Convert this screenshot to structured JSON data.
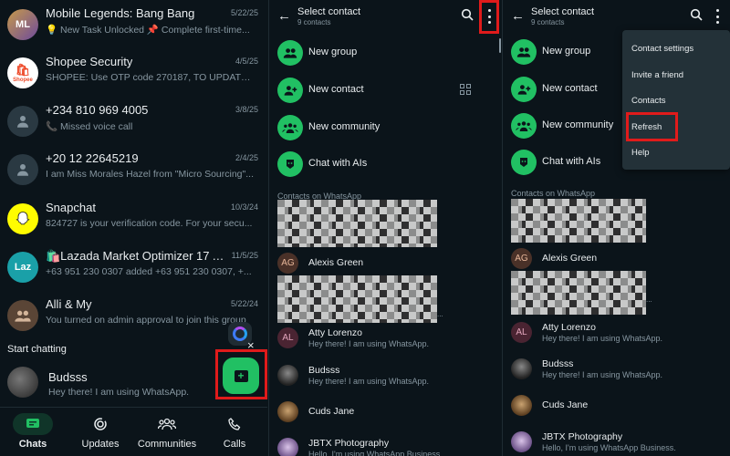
{
  "chats_panel": {
    "chats": [
      {
        "name": "Mobile Legends: Bang Bang",
        "date": "5/22/25",
        "preview": "💡 New Task Unlocked 📌 Complete first-time...",
        "avatar_text": "ML"
      },
      {
        "name": "Shopee Security",
        "date": "4/5/25",
        "preview": "SHOPEE: Use OTP code 270187, TO UPDATE P...",
        "avatar_text": "Shopee"
      },
      {
        "name": "+234 810 969 4005",
        "date": "3/8/25",
        "preview": "📞 Missed voice call",
        "avatar_text": ""
      },
      {
        "name": "+20 12 22645219",
        "date": "2/4/25",
        "preview": "I am Miss Morales Hazel from \"Micro Sourcing\"...",
        "avatar_text": ""
      },
      {
        "name": "Snapchat",
        "date": "10/3/24",
        "preview": "824727 is your verification code. For your secu...",
        "avatar_text": ""
      },
      {
        "name": "🛍️Lazada Market Optimizer 17 A...",
        "date": "11/5/25",
        "preview": "+63 951 230 0307 added +63 951 230 0307, +...",
        "avatar_text": "Laz"
      },
      {
        "name": "Alli & My",
        "date": "5/22/24",
        "preview": "You turned on admin approval to join this group",
        "avatar_text": ""
      }
    ],
    "start_chatting_label": "Start chatting",
    "suggested": {
      "name": "Budsss",
      "status": "Hey there! I am using WhatsApp."
    },
    "close_symbol": "×",
    "fab_glyph": "+",
    "nav": [
      {
        "label": "Chats",
        "icon": "chats-icon",
        "active": true
      },
      {
        "label": "Updates",
        "icon": "updates-icon",
        "active": false
      },
      {
        "label": "Communities",
        "icon": "communities-icon",
        "active": false
      },
      {
        "label": "Calls",
        "icon": "calls-icon",
        "active": false
      }
    ]
  },
  "select_contact": {
    "back_symbol": "←",
    "title": "Select contact",
    "subtitle": "9 contacts",
    "actions": [
      {
        "label": "New group",
        "icon": "new-group-icon"
      },
      {
        "label": "New contact",
        "icon": "new-contact-icon"
      },
      {
        "label": "New community",
        "icon": "new-community-icon"
      },
      {
        "label": "Chat with AIs",
        "icon": "ai-chat-icon"
      }
    ],
    "section_label": "Contacts on WhatsApp",
    "pixel_tail": "...",
    "contacts": [
      {
        "name": "Alexis Green",
        "status": "",
        "initials": "AG"
      },
      {
        "name": "Atty Lorenzo",
        "status": "Hey there! I am using WhatsApp.",
        "initials": "AL"
      },
      {
        "name": "Budsss",
        "status": "Hey there! I am using WhatsApp.",
        "initials": ""
      },
      {
        "name": "Cuds Jane",
        "status": "",
        "initials": ""
      },
      {
        "name": "JBTX Photography",
        "status": "Hello, I'm using WhatsApp Business.",
        "initials": ""
      }
    ]
  },
  "menu": {
    "items": [
      "Contact settings",
      "Invite a friend",
      "Contacts",
      "Refresh",
      "Help"
    ]
  },
  "colors": {
    "accent": "#21c063",
    "highlight": "#e01b1b",
    "background": "#0b141a"
  }
}
